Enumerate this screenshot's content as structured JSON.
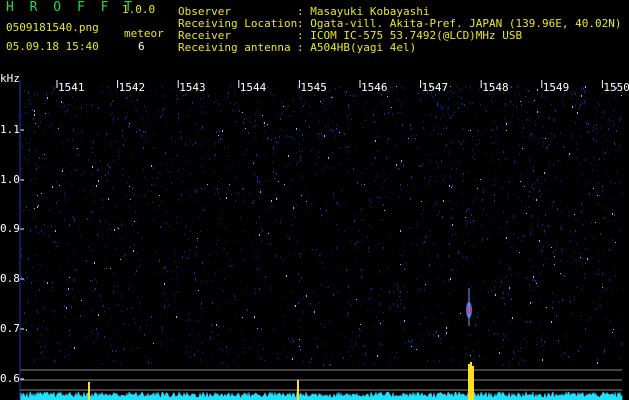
{
  "header": {
    "app_name": "H R O F F T",
    "version": "1.0.0",
    "filename": "0509181540.png",
    "datetime": "05.09.18 15:40",
    "meteor_label": "meteor",
    "meteor_count": "6"
  },
  "info": {
    "observer_label": "Observer",
    "observer_value": ": Masayuki Kobayashi",
    "location_label": "Receiving Location",
    "location_value": ": Ogata-vill. Akita-Pref. JAPAN (139.96E, 40.02N)",
    "receiver_label": "Receiver",
    "receiver_value": ": ICOM IC-575 53.7492(@LCD)MHz USB",
    "antenna_label": "Receiving antenna",
    "antenna_value": ": A504HB(yagi 4el)"
  },
  "spectrogram": {
    "y_unit": "kHz",
    "y_ticks": [
      "1.1",
      "1.0",
      "0.9",
      "0.8",
      "0.7",
      "0.6"
    ],
    "x_ticks": [
      "1541",
      "1542",
      "1543",
      "1544",
      "1545",
      "1546",
      "1547",
      "1548",
      "1549",
      "1550"
    ],
    "colors": {
      "background": "#000000",
      "noise": "#1a2cc8",
      "meteor": "#ff2020",
      "amplitude": "#20e0ff",
      "spike": "#ffe020",
      "ref_line": "#ffffff"
    }
  }
}
